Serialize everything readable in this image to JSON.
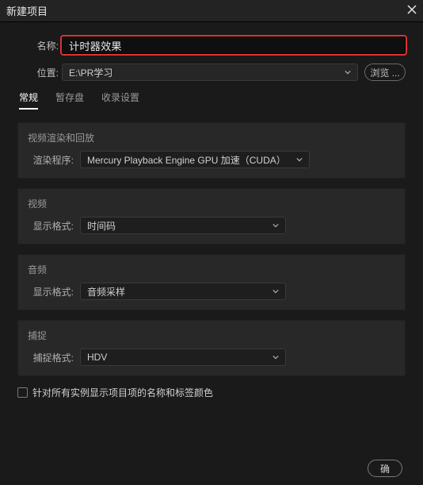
{
  "titlebar": {
    "title": "新建项目"
  },
  "form": {
    "name_label": "名称:",
    "name_value": "计时器效果",
    "location_label": "位置:",
    "location_value": "E:\\PR学习",
    "browse_label": "浏览 ..."
  },
  "tabs": {
    "general": "常规",
    "scratch": "暂存盘",
    "ingest": "收录设置"
  },
  "sections": {
    "render": {
      "title": "视频渲染和回放",
      "label": "渲染程序:",
      "value": "Mercury Playback Engine GPU 加速（CUDA）"
    },
    "video": {
      "title": "视频",
      "label": "显示格式:",
      "value": "时间码"
    },
    "audio": {
      "title": "音频",
      "label": "显示格式:",
      "value": "音频采样"
    },
    "capture": {
      "title": "捕捉",
      "label": "捕捉格式:",
      "value": "HDV"
    }
  },
  "checkbox_label": "针对所有实例显示项目项的名称和标签颜色",
  "buttons": {
    "ok": "确"
  }
}
